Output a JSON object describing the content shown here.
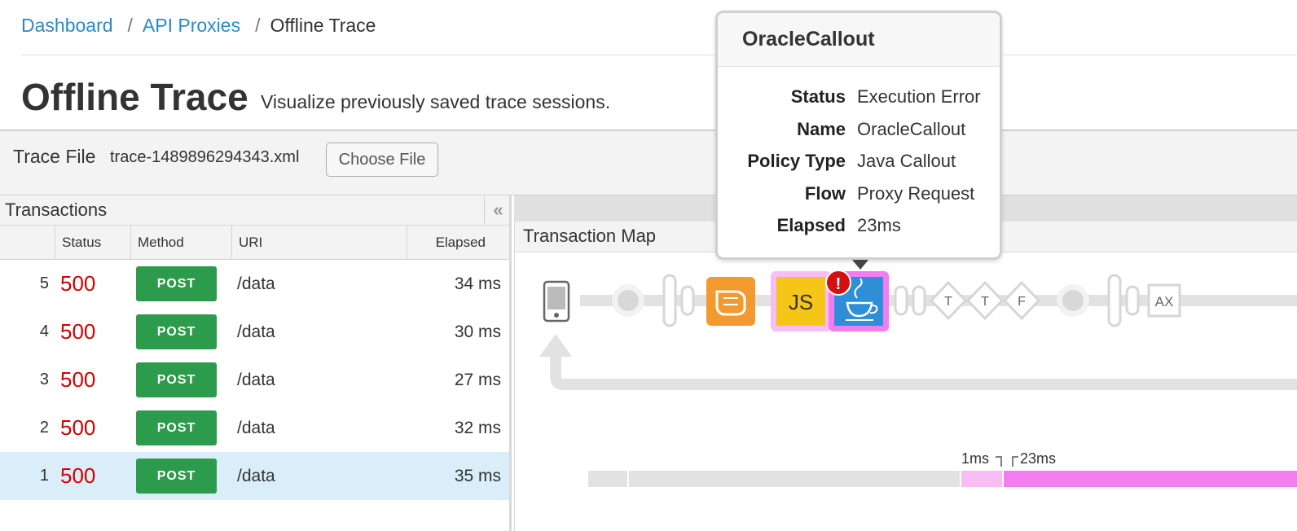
{
  "breadcrumb": {
    "items": [
      "Dashboard",
      "API Proxies"
    ],
    "separator": "/",
    "current": "Offline Trace"
  },
  "page": {
    "title": "Offline Trace",
    "subtitle": "Visualize previously saved trace sessions."
  },
  "trace_file": {
    "label": "Trace File",
    "file_name": "trace-1489896294343.xml",
    "choose_button": "Choose File"
  },
  "transactions": {
    "title": "Transactions",
    "collapse_icon": "double-chevron-left-icon",
    "columns": [
      "Status",
      "Method",
      "URI",
      "Elapsed"
    ],
    "rows": [
      {
        "num": "5",
        "status": "500",
        "method": "POST",
        "uri": "/data",
        "elapsed": "34 ms"
      },
      {
        "num": "4",
        "status": "500",
        "method": "POST",
        "uri": "/data",
        "elapsed": "30 ms"
      },
      {
        "num": "3",
        "status": "500",
        "method": "POST",
        "uri": "/data",
        "elapsed": "27 ms"
      },
      {
        "num": "2",
        "status": "500",
        "method": "POST",
        "uri": "/data",
        "elapsed": "32 ms"
      },
      {
        "num": "1",
        "status": "500",
        "method": "POST",
        "uri": "/data",
        "elapsed": "35 ms",
        "selected": true
      }
    ]
  },
  "transaction_map": {
    "title": "Transaction Map",
    "steps": {
      "js_label": "JS",
      "t1": "T",
      "t2": "T",
      "f": "F",
      "ax": "AX",
      "error_mark": "!"
    },
    "timeline": {
      "label_a": "1ms",
      "label_b": "23ms"
    }
  },
  "popover": {
    "title": "OracleCallout",
    "fields": [
      {
        "key": "Status",
        "value": "Execution Error"
      },
      {
        "key": "Name",
        "value": "OracleCallout"
      },
      {
        "key": "Policy Type",
        "value": "Java Callout"
      },
      {
        "key": "Flow",
        "value": "Proxy Request"
      },
      {
        "key": "Elapsed",
        "value": "23ms"
      }
    ]
  },
  "colors": {
    "link": "#2a8ac8",
    "status_error": "#d40000",
    "method_post": "#2d9b4c",
    "selected_row": "#d9eef8",
    "highlight_pink": "#f27cf0",
    "js_yellow": "#f5c518",
    "java_blue": "#2f8fd6",
    "extract_orange": "#f39a2e"
  }
}
